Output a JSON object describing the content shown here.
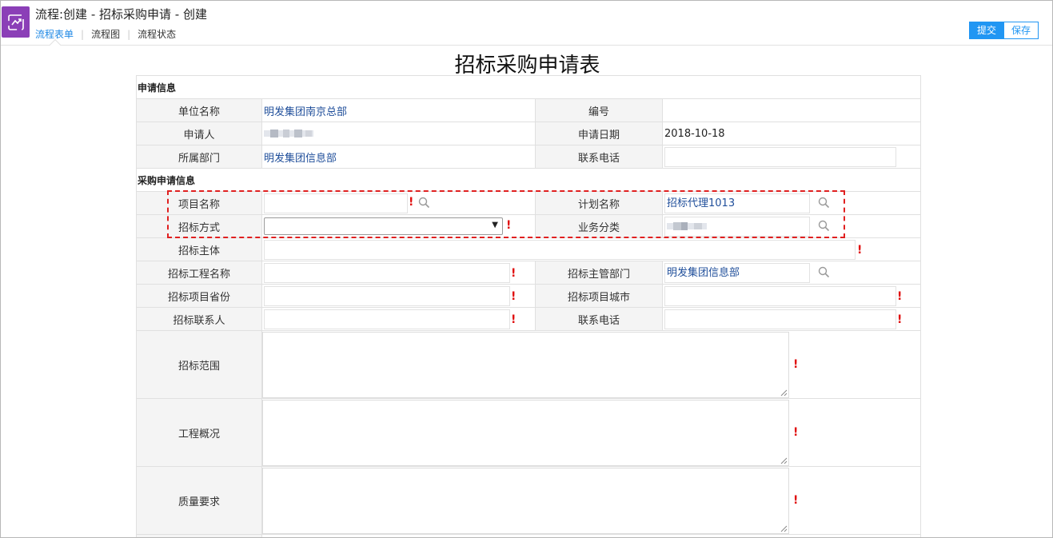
{
  "header": {
    "title": "流程:创建 - 招标采购申请 - 创建",
    "tabs": [
      "流程表单",
      "流程图",
      "流程状态"
    ],
    "submit_label": "提交",
    "save_label": "保存"
  },
  "form": {
    "title": "招标采购申请表",
    "section_apply": "申请信息",
    "section_purchase": "采购申请信息",
    "unit_name_label": "单位名称",
    "unit_name_value": "明发集团南京总部",
    "number_label": "编号",
    "applicant_label": "申请人",
    "apply_date_label": "申请日期",
    "apply_date_value": "2018-10-18",
    "department_label": "所属部门",
    "department_value": "明发集团信息部",
    "phone_label": "联系电话",
    "project_name_label": "项目名称",
    "plan_name_label": "计划名称",
    "plan_name_value": "招标代理1013",
    "bid_method_label": "招标方式",
    "business_category_label": "业务分类",
    "bid_subject_label": "招标主体",
    "bid_project_name_label": "招标工程名称",
    "bid_dept_label": "招标主管部门",
    "bid_dept_value": "明发集团信息部",
    "bid_province_label": "招标项目省份",
    "bid_city_label": "招标项目城市",
    "bid_contact_label": "招标联系人",
    "bid_phone_label": "联系电话",
    "bid_scope_label": "招标范围",
    "project_overview_label": "工程概况",
    "quality_label": "质量要求"
  },
  "colors": {
    "accent": "#2196f3",
    "link": "#1f4e9a",
    "required": "#e01010",
    "app_icon": "#8b3fb7"
  }
}
